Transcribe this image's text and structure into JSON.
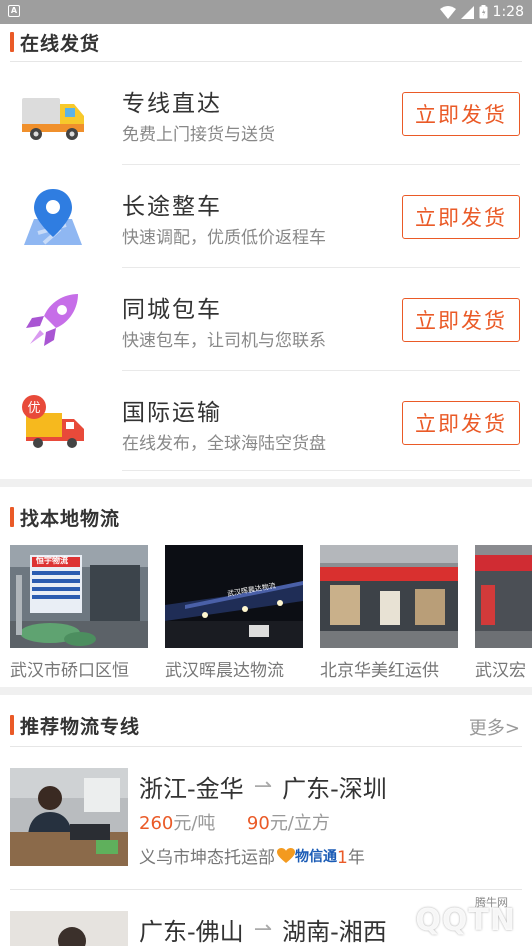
{
  "status_bar": {
    "time": "1:28"
  },
  "online_shipping": {
    "title": "在线发货",
    "items": [
      {
        "name": "专线直达",
        "desc": "免费上门接货与送货",
        "button": "立即发货",
        "icon": "truck-icon"
      },
      {
        "name": "长途整车",
        "desc": "快速调配，优质低价返程车",
        "button": "立即发货",
        "icon": "map-pin-icon"
      },
      {
        "name": "同城包车",
        "desc": "快速包车，让司机与您联系",
        "button": "立即发货",
        "icon": "rocket-icon"
      },
      {
        "name": "国际运输",
        "desc": "在线发布，全球海陆空货盘",
        "button": "立即发货",
        "icon": "discount-truck-icon"
      }
    ],
    "discount_badge": "优"
  },
  "local_logistics": {
    "title": "找本地物流",
    "cards": [
      {
        "caption": "武汉市硚口区恒",
        "sign": "恒宇物流"
      },
      {
        "caption": "武汉晖晨达物流",
        "sign": "武汉晖晨达物流"
      },
      {
        "caption": "北京华美红运供",
        "sign": ""
      },
      {
        "caption": "武汉宏",
        "sign": ""
      }
    ]
  },
  "recommended": {
    "title": "推荐物流专线",
    "more": "更多>",
    "routes": [
      {
        "from": "浙江-金华",
        "to": "广东-深圳",
        "price_ton": "260",
        "price_ton_unit": "元/吨",
        "price_cube": "90",
        "price_cube_unit": "元/立方",
        "company": "义乌市坤态托运部",
        "badge": "物信通",
        "years": "1",
        "years_unit": "年"
      },
      {
        "from": "广东-佛山",
        "to": "湖南-湘西"
      }
    ]
  },
  "watermark": {
    "text": "QQTN",
    "small": "腾牛网"
  },
  "colors": {
    "accent": "#ea5a27",
    "status_bar": "#9e9e9e"
  }
}
